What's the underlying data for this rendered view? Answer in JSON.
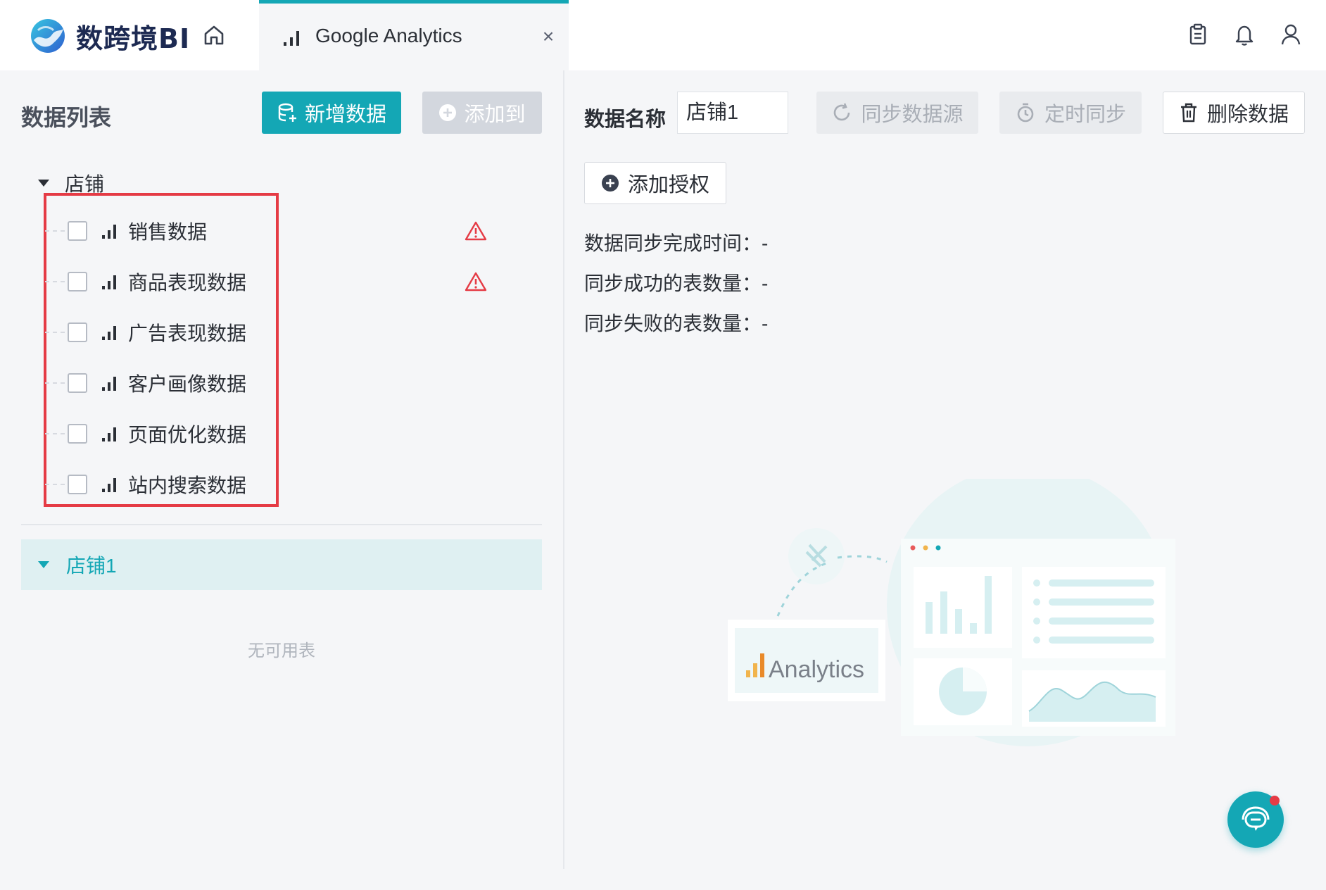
{
  "header": {
    "logo_text": "数跨境BI",
    "tab_label": "Google Analytics",
    "tab_close": "×",
    "icons": [
      "home-icon",
      "clipboard-icon",
      "bell-icon",
      "user-icon"
    ]
  },
  "left": {
    "title": "数据列表",
    "new_data_label": "新增数据",
    "add_to_label": "添加到",
    "root_label": "店铺",
    "items": [
      {
        "label": "销售数据",
        "warning": true
      },
      {
        "label": "商品表现数据",
        "warning": true
      },
      {
        "label": "广告表现数据",
        "warning": false
      },
      {
        "label": "客户画像数据",
        "warning": false
      },
      {
        "label": "页面优化数据",
        "warning": false
      },
      {
        "label": "站内搜索数据",
        "warning": false
      }
    ],
    "store1_label": "店铺1",
    "empty_text": "无可用表"
  },
  "right": {
    "name_label": "数据名称",
    "name_value": "店铺1",
    "sync_label": "同步数据源",
    "timer_label": "定时同步",
    "delete_label": "删除数据",
    "auth_label": "添加授权",
    "info": [
      "数据同步完成时间：-",
      "同步成功的表数量：-",
      "同步失败的表数量：-"
    ],
    "illustration_text": "Analytics"
  },
  "colors": {
    "accent": "#14a7b5",
    "warning": "#e53b45",
    "disabled": "#d3d7de"
  }
}
